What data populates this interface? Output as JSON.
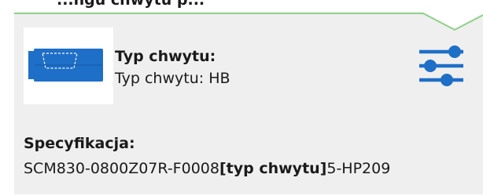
{
  "header": {
    "title_partial": "...ngu chwytu p..."
  },
  "grip": {
    "label": "Typ chwytu:",
    "value": "Typ chwytu: HB",
    "image_icon": "shank-hb-icon"
  },
  "filter_button": {
    "icon": "sliders-icon"
  },
  "specification": {
    "label": "Specyfikacja:",
    "code_prefix": "SCM830-0800Z07R-F0008",
    "code_highlight": "[typ chwytu]",
    "code_suffix": "5-HP209"
  },
  "colors": {
    "accent_green": "#8ed08a",
    "icon_blue": "#1e6fc8",
    "card_bg": "#efefef"
  }
}
